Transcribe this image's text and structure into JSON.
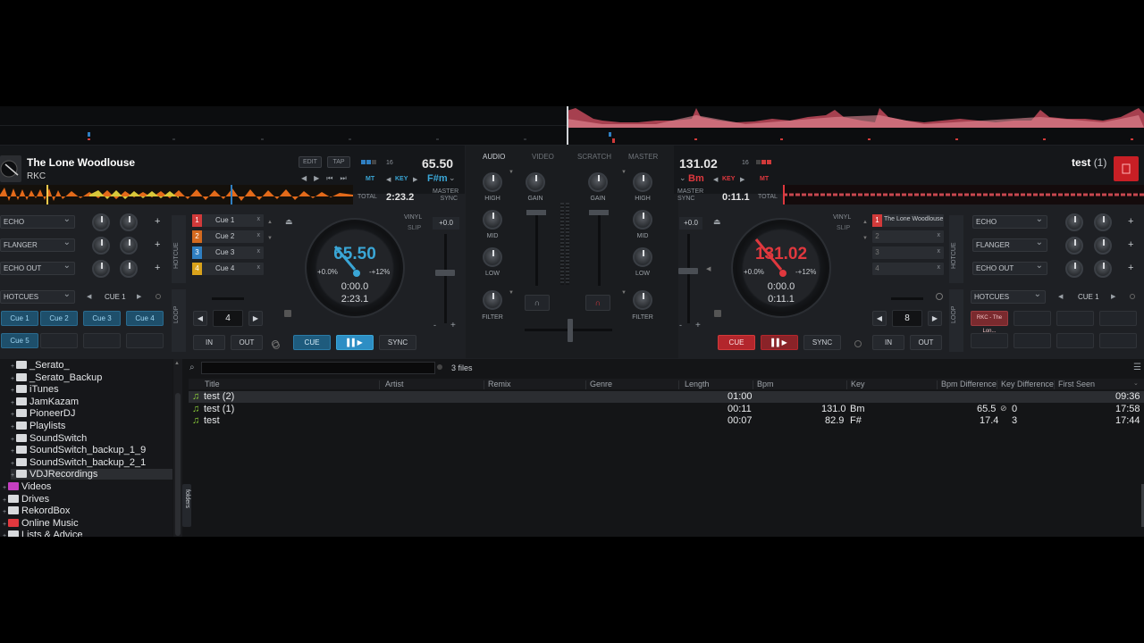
{
  "deck_left": {
    "title": "The Lone Woodlouse",
    "artist": "RKC",
    "edit_label": "EDIT",
    "tap_label": "TAP",
    "beat_count": "16",
    "bpm": "65.50",
    "mt_label": "MT",
    "key_label": "KEY",
    "key": "F#m",
    "total_label": "TOTAL",
    "total_time": "2:23.2",
    "master_label": "MASTER",
    "sync_label": "SYNC",
    "effects": [
      "ECHO",
      "FLANGER",
      "ECHO OUT"
    ],
    "hotcues_label": "HOTCUES",
    "hotcue_side_label": "HOTCUE",
    "cue_nav": "CUE 1",
    "hotcue_buttons": [
      "Cue 1",
      "Cue 2",
      "Cue 3",
      "Cue 4",
      "Cue 5"
    ],
    "cues": [
      {
        "num": "1",
        "label": "Cue 1",
        "color": "#d13a3a"
      },
      {
        "num": "2",
        "label": "Cue 2",
        "color": "#d46a1f"
      },
      {
        "num": "3",
        "label": "Cue 3",
        "color": "#2f7fc2"
      },
      {
        "num": "4",
        "label": "Cue 4",
        "color": "#d9a21b"
      }
    ],
    "loop_label": "LOOP",
    "loop_size": "4",
    "in_label": "IN",
    "out_label": "OUT",
    "vinyl_label": "VINYL",
    "slip_label": "SLIP",
    "pitch_offset": "+0.0",
    "platter_bpm": "65.50",
    "pitch_pct": "+0.0%",
    "pitch_range": "-+12%",
    "elapsed": "0:00.0",
    "remaining": "2:23.1",
    "cue_label": "CUE",
    "play_label": "▌▌▶",
    "sync_btn": "SYNC"
  },
  "deck_right": {
    "title": "test",
    "title_suffix": "(1)",
    "bpm": "131.02",
    "beat_count": "16",
    "key": "Bm",
    "key_label": "KEY",
    "mt_label": "MT",
    "master_label": "MASTER",
    "sync_label": "SYNC",
    "remaining_head": "0:11.1",
    "total_label": "TOTAL",
    "effects": [
      "ECHO",
      "FLANGER",
      "ECHO OUT"
    ],
    "hotcues_label": "HOTCUES",
    "hotcue_side_label": "HOTCUE",
    "cue_nav": "CUE 1",
    "hotcue_first": "RKC - The Lon...",
    "cues": [
      {
        "num": "1",
        "label": "The Lone Woodlouse",
        "color": "#d13a3a"
      },
      {
        "num": "2",
        "label": "",
        "color": ""
      },
      {
        "num": "3",
        "label": "",
        "color": ""
      },
      {
        "num": "4",
        "label": "",
        "color": ""
      }
    ],
    "loop_label": "LOOP",
    "loop_size": "8",
    "in_label": "IN",
    "out_label": "OUT",
    "vinyl_label": "VINYL",
    "slip_label": "SLIP",
    "pitch_offset": "+0.0",
    "platter_bpm": "131.02",
    "pitch_pct": "+0.0%",
    "pitch_range": "-+12%",
    "elapsed": "0:00.0",
    "remaining": "0:11.1",
    "cue_label": "CUE",
    "play_label": "▌▌▶",
    "sync_btn": "SYNC"
  },
  "mixer": {
    "tabs": [
      "AUDIO",
      "VIDEO",
      "SCRATCH",
      "MASTER"
    ],
    "labels": {
      "high": "HIGH",
      "mid": "MID",
      "low": "LOW",
      "filter": "FILTER",
      "gain": "GAIN"
    }
  },
  "browser": {
    "search_placeholder": "",
    "file_count": "3 files",
    "folders_tab": "folders",
    "tree": [
      {
        "label": "_Serato_",
        "level": 1,
        "color": "#d8dadd"
      },
      {
        "label": "_Serato_Backup",
        "level": 1,
        "color": "#d8dadd"
      },
      {
        "label": "iTunes",
        "level": 1,
        "color": "#d8dadd"
      },
      {
        "label": "JamKazam",
        "level": 1,
        "color": "#d8dadd"
      },
      {
        "label": "PioneerDJ",
        "level": 1,
        "color": "#d8dadd"
      },
      {
        "label": "Playlists",
        "level": 1,
        "color": "#d8dadd"
      },
      {
        "label": "SoundSwitch",
        "level": 1,
        "color": "#d8dadd"
      },
      {
        "label": "SoundSwitch_backup_1_9",
        "level": 1,
        "color": "#d8dadd"
      },
      {
        "label": "SoundSwitch_backup_2_1",
        "level": 1,
        "color": "#d8dadd"
      },
      {
        "label": "VDJRecordings",
        "level": 1,
        "color": "#d8dadd"
      },
      {
        "label": "Videos",
        "level": 0,
        "color": "#c43fc0"
      },
      {
        "label": "Drives",
        "level": 0,
        "color": "#d8dadd"
      },
      {
        "label": "RekordBox",
        "level": 0,
        "color": "#d8dadd"
      },
      {
        "label": "Online Music",
        "level": 0,
        "color": "#e0383e"
      },
      {
        "label": "Lists & Advice",
        "level": 0,
        "color": "#d8dadd"
      }
    ],
    "columns": [
      "Title",
      "Artist",
      "Remix",
      "Genre",
      "Length",
      "Bpm",
      "Key",
      "Bpm Difference",
      "Key Difference",
      "First Seen"
    ],
    "rows": [
      {
        "title": "test (2)",
        "length": "01:00",
        "bpm": "",
        "key": "",
        "bpm_diff": "",
        "key_diff": "",
        "first_seen": "09:36"
      },
      {
        "title": "test (1)",
        "length": "00:11",
        "bpm": "131.0",
        "key": "Bm",
        "bpm_diff": "65.5",
        "key_diff": "0",
        "first_seen": "17:58"
      },
      {
        "title": "test",
        "length": "00:07",
        "bpm": "82.9",
        "key": "F#",
        "bpm_diff": "17.4",
        "key_diff": "3",
        "first_seen": "17:44"
      }
    ]
  }
}
